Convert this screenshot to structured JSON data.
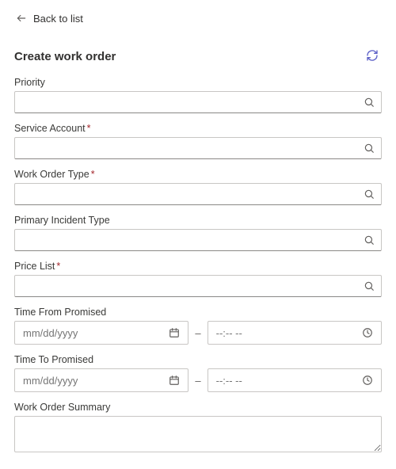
{
  "nav": {
    "back_label": "Back to list"
  },
  "header": {
    "title": "Create work order"
  },
  "fields": {
    "priority": {
      "label": "Priority",
      "required": false
    },
    "serviceAccount": {
      "label": "Service Account",
      "required": true
    },
    "workOrderType": {
      "label": "Work Order Type",
      "required": true
    },
    "incidentType": {
      "label": "Primary Incident Type",
      "required": false
    },
    "priceList": {
      "label": "Price List",
      "required": true
    },
    "timeFrom": {
      "label": "Time From Promised",
      "date_placeholder": "mm/dd/yyyy",
      "time_placeholder": "--:-- --"
    },
    "timeTo": {
      "label": "Time To Promised",
      "date_placeholder": "mm/dd/yyyy",
      "time_placeholder": "--:-- --"
    },
    "summary": {
      "label": "Work Order Summary"
    }
  },
  "glyphs": {
    "separator": "–",
    "required_mark": "*"
  }
}
